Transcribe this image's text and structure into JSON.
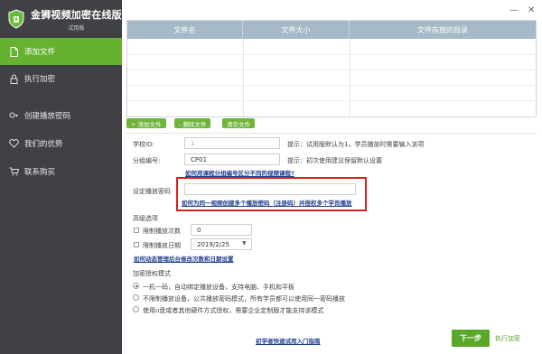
{
  "app": {
    "title": "金狮视频加密在线版",
    "subtitle": "试用版"
  },
  "window": {
    "minimize": "—",
    "close": "✕"
  },
  "sidebar": {
    "items": [
      {
        "label": "添加文件",
        "icon": "file-icon",
        "active": true
      },
      {
        "label": "执行加密",
        "icon": "lock-icon",
        "active": false
      },
      {
        "label": "创建播放密码",
        "icon": "key-icon",
        "active": false
      },
      {
        "label": "我们的优势",
        "icon": "heart-icon",
        "active": false
      },
      {
        "label": "联系购买",
        "icon": "cart-icon",
        "active": false
      }
    ]
  },
  "file_table": {
    "headers": [
      "文件名",
      "文件大小",
      "文件存放的目录"
    ],
    "rows": []
  },
  "toolbar": {
    "add_label": "+ 添加文件",
    "delete_label": "- 删除文件",
    "clear_label": "清空文件"
  },
  "form": {
    "school_id_label": "学校ID:",
    "school_id_value": "1",
    "school_id_hint": "提示：试用版默认为1，学员播放时需要输入该项",
    "group_label": "分组编号:",
    "group_value": "CP01",
    "group_hint": "提示：初次使用建议保留默认设置",
    "group_link": "如何用课程分组编号区分不同的视频课程?",
    "password_label": "设定播放密码",
    "password_link": "如何为同一视频创建多个播放密码（注册码）并授权多个学员播放",
    "advanced_label": "高级选项",
    "limit_count_label": "限制播放次数",
    "limit_count_value": "0",
    "limit_date_label": "限制播放日期",
    "limit_date_value": "2019/2/25",
    "advanced_link": "如何动态管理后台修改次数和日期设置",
    "auth_label": "加密授权模式",
    "auth_options": [
      {
        "label": "一机一码，自动绑定播放设备，支持电脑、手机和平板",
        "selected": true
      },
      {
        "label": "不限制播放设备，公共播放密码模式，所有学员都可以使用同一密码播放",
        "selected": false
      },
      {
        "label": "使用u盘或者其他硬件方式授权，需要企业定制版才能支持该模式",
        "selected": false
      }
    ]
  },
  "footer": {
    "guide_link": "初学者快速试用入门指南",
    "next_label": "下一步",
    "exec_label": "执行加密"
  },
  "colors": {
    "accent": "#65b230",
    "sidebar_bg": "#3f4144",
    "header_bg": "#a6b9c7",
    "highlight": "#d82020"
  }
}
